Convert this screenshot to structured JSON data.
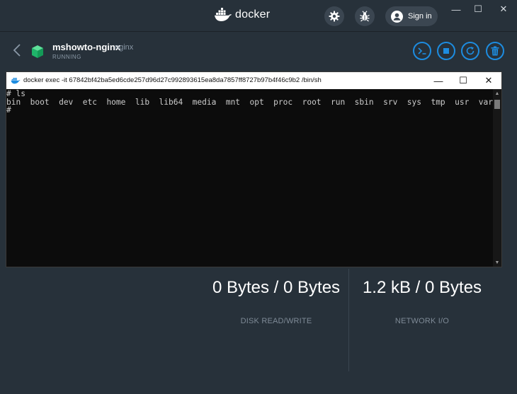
{
  "app": {
    "name": "docker"
  },
  "titlebar": {
    "signin_label": "Sign in",
    "settings_icon": "gear-icon",
    "bug_icon": "bug-icon",
    "minimize": "—",
    "maximize": "☐",
    "close": "✕"
  },
  "container": {
    "name": "mshowto-nginx",
    "image": "nginx",
    "status": "RUNNING",
    "actions": [
      "cli-icon",
      "stop-icon",
      "restart-icon",
      "delete-icon"
    ],
    "accent": "#1d8ce0",
    "cube_color": "#1fb56a"
  },
  "terminal": {
    "title": "docker  exec -it 67842bf42ba5ed6cde257d96d27c992893615ea8da7857ff8727b97b4f46c9b2 /bin/sh",
    "lines": [
      "# ls",
      "bin  boot  dev  etc  home  lib  lib64  media  mnt  opt  proc  root  run  sbin  srv  sys  tmp  usr  var",
      "#"
    ]
  },
  "stats": {
    "disk": {
      "value": "0 Bytes / 0 Bytes",
      "label": "DISK READ/WRITE"
    },
    "network": {
      "value": "1.2 kB / 0 Bytes",
      "label": "NETWORK I/O"
    }
  }
}
